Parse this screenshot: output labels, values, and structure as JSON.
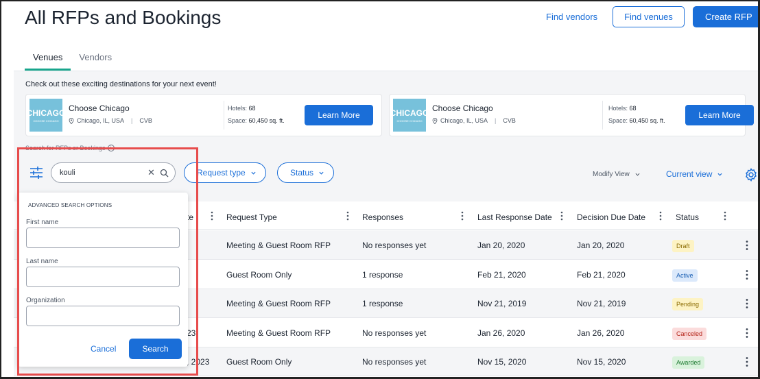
{
  "header": {
    "title": "All RFPs and Bookings",
    "find_vendors": "Find vendors",
    "find_venues": "Find venues",
    "create_rfp": "Create RFP"
  },
  "tabs": [
    {
      "label": "Venues",
      "active": true
    },
    {
      "label": "Vendors",
      "active": false
    }
  ],
  "promo": {
    "heading": "Check out these exciting destinations for your next event!",
    "cards": [
      {
        "logo_text": "CHICAGO",
        "logo_sub": "CHOOSE CHICAGO",
        "name": "Choose Chicago",
        "location": "Chicago, IL, USA",
        "type": "CVB",
        "hotels_label": "Hotels:",
        "hotels_value": "68",
        "space_label": "Space:",
        "space_value": "60,450 sq. ft.",
        "button": "Learn More"
      },
      {
        "logo_text": "CHICAGO",
        "logo_sub": "CHOOSE CHICAGO",
        "name": "Choose Chicago",
        "location": "Chicago, IL, USA",
        "type": "CVB",
        "hotels_label": "Hotels:",
        "hotels_value": "68",
        "space_label": "Space:",
        "space_value": "60,450 sq. ft.",
        "button": "Learn More"
      }
    ]
  },
  "search": {
    "hint": "Search for RFPs or Bookings",
    "value": "kouli",
    "clear_symbol": "✕",
    "request_type": "Request type",
    "status": "Status",
    "modify_view": "Modify View",
    "current_view": "Current view"
  },
  "advanced_search": {
    "title": "ADVANCED SEARCH OPTIONS",
    "first_name": "First name",
    "last_name": "Last name",
    "organization": "Organization",
    "cancel": "Cancel",
    "search": "Search"
  },
  "table": {
    "columns": [
      "te",
      "Request Type",
      "Responses",
      "Last Response Date",
      "Decision Due Date",
      "Status"
    ],
    "rows": [
      {
        "partial": "",
        "request_type": "Meeting & Guest Room RFP",
        "responses": "No responses yet",
        "last_response": "Jan 20, 2020",
        "decision_due": "Jan 20, 2020",
        "status": "Draft"
      },
      {
        "partial": "",
        "request_type": "Guest Room Only",
        "responses": "1 response",
        "last_response": "Feb 21, 2020",
        "decision_due": "Feb 21, 2020",
        "status": "Active"
      },
      {
        "partial": "",
        "request_type": "Meeting & Guest Room RFP",
        "responses": "1 response",
        "last_response": "Nov 21, 2019",
        "decision_due": "Nov 21, 2019",
        "status": "Pending"
      },
      {
        "partial": "23",
        "request_type": "Meeting & Guest Room RFP",
        "responses": "No responses yet",
        "last_response": "Jan 26, 2020",
        "decision_due": "Jan 26, 2020",
        "status": "Canceled"
      },
      {
        "partial": ", 2023",
        "request_type": "Guest Room Only",
        "responses": "No responses yet",
        "last_response": "Nov 15, 2020",
        "decision_due": "Nov 15, 2020",
        "status": "Awarded"
      }
    ]
  },
  "status_colors": {
    "Draft": {
      "bg": "#fdf3c4",
      "fg": "#8a6a00"
    },
    "Active": {
      "bg": "#dbe9fb",
      "fg": "#1a5fb4"
    },
    "Pending": {
      "bg": "#fdf3c4",
      "fg": "#8a6a00"
    },
    "Canceled": {
      "bg": "#fbdcdc",
      "fg": "#b42318"
    },
    "Awarded": {
      "bg": "#d9f2dc",
      "fg": "#1e7a32"
    }
  },
  "colors": {
    "accent": "#1a6ed8",
    "tab_indicator": "#18a58c",
    "highlight": "#e74c4c"
  }
}
